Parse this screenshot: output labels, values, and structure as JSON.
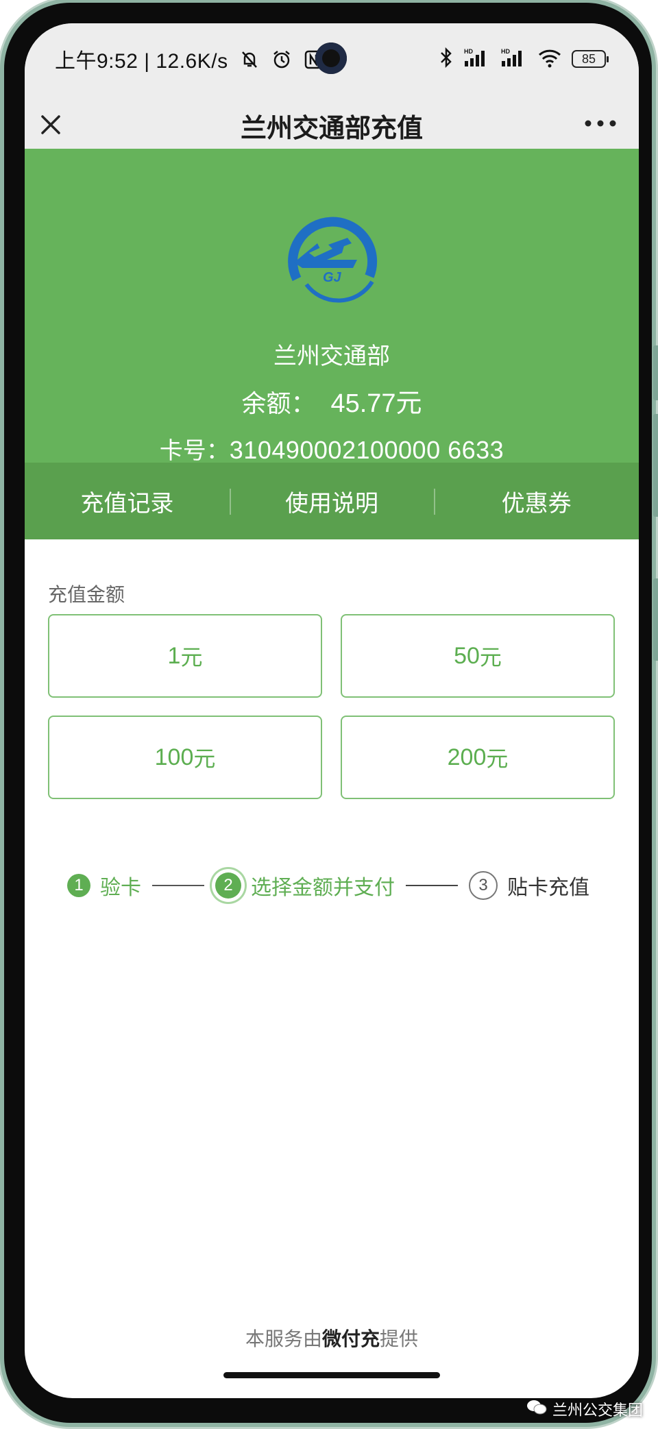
{
  "status_bar": {
    "time_speed": "上午9:52 | 12.6K/s",
    "battery": "85",
    "signal1_label": "HD",
    "signal2_label": "HD"
  },
  "nav": {
    "title": "兰州交通部充值",
    "close_icon": "close-icon",
    "more_icon": "more-icon"
  },
  "card": {
    "name": "兰州交通部",
    "balance_label": "余额：",
    "balance_value": "45.77元",
    "card_label": "卡号：",
    "card_number": "310490002100000 6633",
    "logo_text": "GJ"
  },
  "tabs": [
    "充值记录",
    "使用说明",
    "优惠券"
  ],
  "amount_section": {
    "label": "充值金额",
    "options": [
      {
        "value": "1",
        "unit": "元"
      },
      {
        "value": "50",
        "unit": "元"
      },
      {
        "value": "100",
        "unit": "元"
      },
      {
        "value": "200",
        "unit": "元"
      }
    ]
  },
  "steps": [
    {
      "num": "1",
      "label": "验卡",
      "state": "done"
    },
    {
      "num": "2",
      "label": "选择金额并支付",
      "state": "current"
    },
    {
      "num": "3",
      "label": "贴卡充值",
      "state": "pending"
    }
  ],
  "footer": {
    "prefix": "本服务由",
    "brand": "微付充",
    "suffix": "提供"
  },
  "watermark": "兰州公交集团",
  "colors": {
    "green": "#66b35b",
    "tab_green": "#5aa04e",
    "accent": "#5fae53"
  }
}
